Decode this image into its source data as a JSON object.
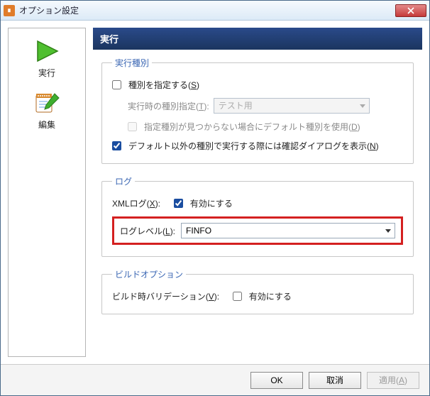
{
  "window": {
    "title": "オプション設定"
  },
  "sidebar": {
    "items": [
      {
        "label": "実行"
      },
      {
        "label": "編集"
      }
    ]
  },
  "main": {
    "header": "実行",
    "groups": {
      "run_type": {
        "legend": "実行種別",
        "specify_label_pre": "種別を指定する(",
        "specify_key": "S",
        "specify_label_post": ")",
        "specify_checked": false,
        "exec_type_label_pre": "実行時の種別指定(",
        "exec_type_key": "T",
        "exec_type_label_post": "):",
        "exec_type_value": "テスト用",
        "default_fallback_pre": "指定種別が見つからない場合にデフォルト種別を使用(",
        "default_fallback_key": "D",
        "default_fallback_post": ")",
        "default_fallback_checked": false,
        "confirm_dialog_pre": "デフォルト以外の種別で実行する際には確認ダイアログを表示(",
        "confirm_dialog_key": "N",
        "confirm_dialog_post": ")",
        "confirm_dialog_checked": true
      },
      "log": {
        "legend": "ログ",
        "xml_label_pre": "XMLログ(",
        "xml_key": "X",
        "xml_label_post": "):",
        "xml_enable_label": "有効にする",
        "xml_enable_checked": true,
        "level_label_pre": "ログレベル(",
        "level_key": "L",
        "level_label_post": "):",
        "level_value": "FINFO"
      },
      "build": {
        "legend": "ビルドオプション",
        "validation_label_pre": "ビルド時バリデーション(",
        "validation_key": "V",
        "validation_label_post": "):",
        "validation_enable_label": "有効にする",
        "validation_enable_checked": false
      }
    }
  },
  "buttons": {
    "ok": "OK",
    "cancel": "取消",
    "apply_pre": "適用(",
    "apply_key": "A",
    "apply_post": ")"
  }
}
